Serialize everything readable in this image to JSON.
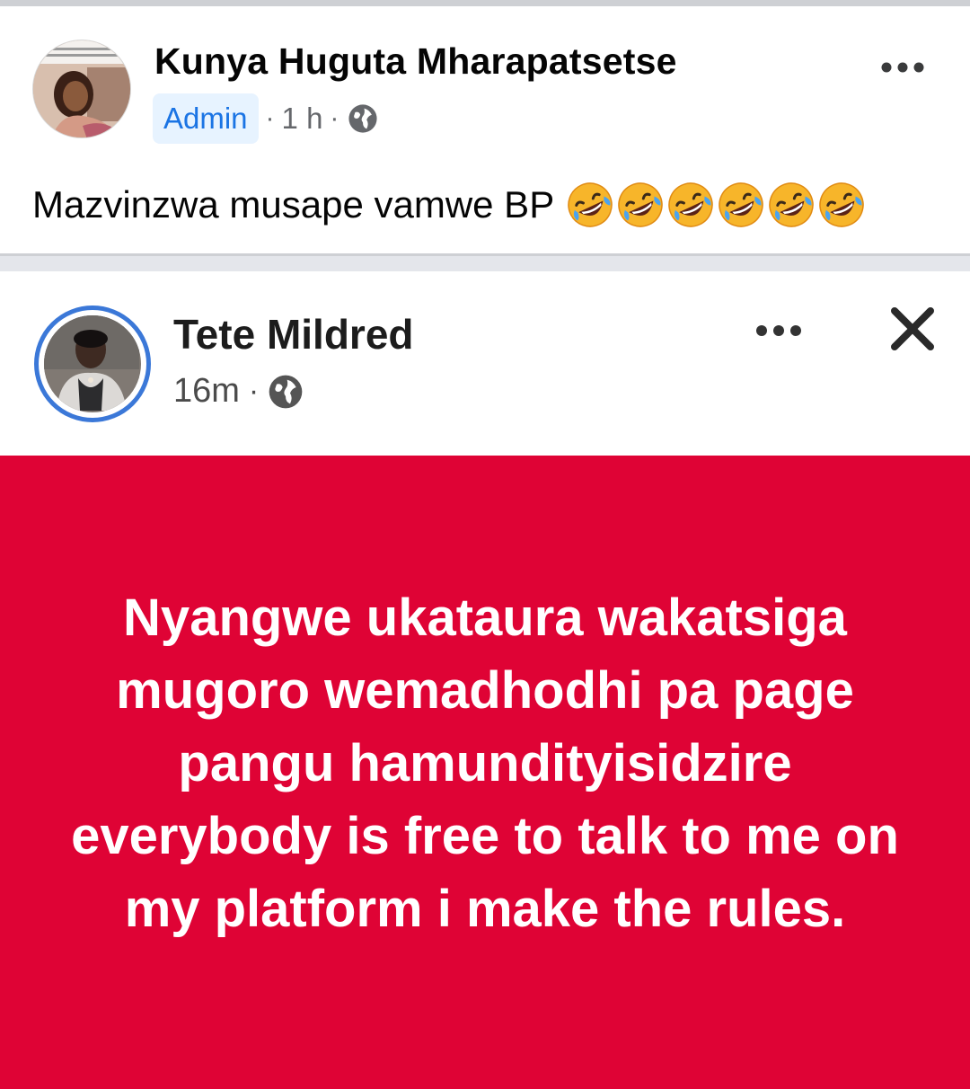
{
  "outer_post": {
    "author": "Kunya Huguta Mharapatsetse",
    "badge": "Admin",
    "separator": "·",
    "time": "1 h",
    "caption": "Mazvinzwa musape vamwe BP",
    "caption_emoji": "rolling-on-floor-laughing",
    "caption_emoji_count": 6
  },
  "shared_post": {
    "author": "Tete Mildred",
    "separator": "·",
    "time": "16m",
    "text": "Nyangwe ukataura wakatsiga mugoro wemadhodhi pa page pangu hamundityisidzire everybody is free to talk to me on my platform i make the rules.",
    "background_color": "#df0335"
  },
  "colors": {
    "admin_badge_bg": "#e7f3ff",
    "admin_badge_text": "#1b74e4",
    "avatar_ring": "#3b78d8",
    "meta_text": "#65676b"
  }
}
